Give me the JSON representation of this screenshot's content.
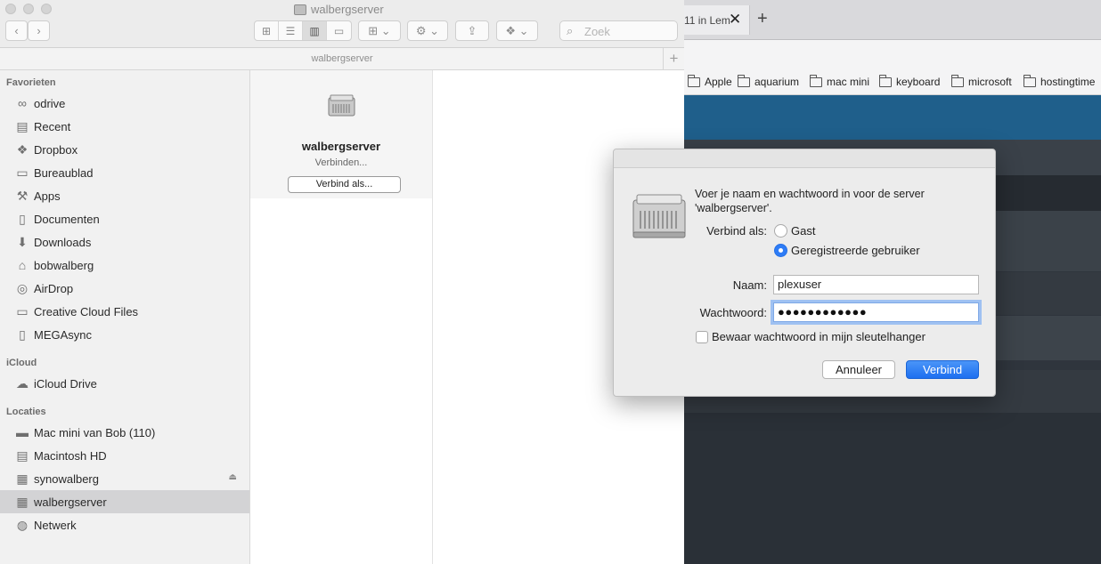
{
  "browser": {
    "tab_title": "11 in Lem",
    "tab_close_glyph": "✕",
    "new_tab_glyph": "+",
    "bookmarks": [
      "Apple",
      "aquarium",
      "mac mini",
      "keyboard",
      "microsoft",
      "hostingtime"
    ]
  },
  "finder": {
    "window_title": "walbergserver",
    "path_title": "walbergserver",
    "search_placeholder": "Zoek",
    "back_glyph": "‹",
    "forward_glyph": "›",
    "add_tab_glyph": "+",
    "view_glyphs": [
      "⊞",
      "☰",
      "▥",
      "▭"
    ],
    "group_glyph": "⊞ ⌄",
    "action_glyph": "⚙ ⌄",
    "share_glyph": "⇪",
    "dropbox_glyph": "❖ ⌄",
    "search_glyph": "⌕",
    "sidebar": {
      "favorites_header": "Favorieten",
      "favorites": [
        {
          "label": "odrive",
          "icon": "∞"
        },
        {
          "label": "Recent",
          "icon": "▤"
        },
        {
          "label": "Dropbox",
          "icon": "❖"
        },
        {
          "label": "Bureaublad",
          "icon": "▭"
        },
        {
          "label": "Apps",
          "icon": "⚒"
        },
        {
          "label": "Documenten",
          "icon": "▯"
        },
        {
          "label": "Downloads",
          "icon": "⬇"
        },
        {
          "label": "bobwalberg",
          "icon": "⌂"
        },
        {
          "label": "AirDrop",
          "icon": "◎"
        },
        {
          "label": "Creative Cloud Files",
          "icon": "▭"
        },
        {
          "label": "MEGAsync",
          "icon": "▯"
        }
      ],
      "icloud_header": "iCloud",
      "icloud": [
        {
          "label": "iCloud Drive",
          "icon": "☁"
        }
      ],
      "locations_header": "Locaties",
      "locations": [
        {
          "label": "Mac mini van Bob (110)",
          "icon": "▬"
        },
        {
          "label": "Macintosh HD",
          "icon": "▤"
        },
        {
          "label": "synowalberg",
          "icon": "▦"
        },
        {
          "label": "walbergserver",
          "icon": "▦"
        },
        {
          "label": "Netwerk",
          "icon": "◍"
        }
      ],
      "eject_glyph": "⏏"
    },
    "column": {
      "server_name": "walbergserver",
      "status": "Verbinden...",
      "connect_as_button": "Verbind als..."
    }
  },
  "dialog": {
    "prompt": "Voer je naam en wachtwoord in voor de server 'walbergserver'.",
    "connect_as_label": "Verbind als:",
    "guest_option": "Gast",
    "registered_option": "Geregistreerde gebruiker",
    "selected_option": "Geregistreerde gebruiker",
    "name_label": "Naam:",
    "name_value": "plexuser",
    "password_label": "Wachtwoord:",
    "password_value": "●●●●●●●●●●●●",
    "remember_label": "Bewaar wachtwoord in mijn sleutelhanger",
    "remember_checked": false,
    "cancel_button": "Annuleer",
    "connect_button": "Verbind"
  },
  "colors": {
    "accent": "#2e7cf6",
    "browser_hero": "#1f5f8b",
    "sidebar_selected": "#d3d3d5"
  }
}
